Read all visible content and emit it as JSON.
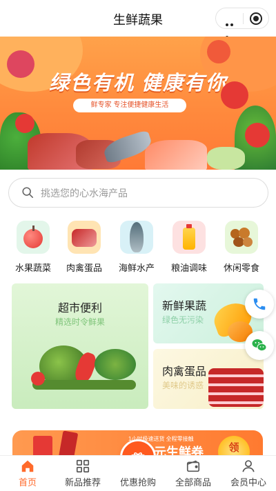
{
  "header": {
    "title": "生鲜蔬果"
  },
  "banner": {
    "headline": "绿色有机 健康有你",
    "tagline": "鲜专家 专注便捷健康生活"
  },
  "search": {
    "placeholder": "挑选您的心水海产品"
  },
  "categories": [
    {
      "label": "水果蔬菜",
      "icon": "apple-icon"
    },
    {
      "label": "肉禽蛋品",
      "icon": "meat-icon"
    },
    {
      "label": "海鲜水产",
      "icon": "fish-icon"
    },
    {
      "label": "粮油调味",
      "icon": "oil-bottle-icon"
    },
    {
      "label": "休闲零食",
      "icon": "snack-icon"
    }
  ],
  "cards": {
    "supermarket": {
      "title": "超市便利",
      "subtitle": "精选时令鲜果"
    },
    "fresh_fruit": {
      "title": "新鲜果蔬",
      "subtitle": "绿色无污染"
    },
    "meat_eggs": {
      "title": "肉禽蛋品",
      "subtitle": "美味的诱惑"
    }
  },
  "promo": {
    "notice": "1小时极速送货 全程零接触",
    "main": "元生鲜券",
    "button": "领"
  },
  "tabbar": {
    "items": [
      {
        "label": "首页",
        "icon": "home-icon",
        "active": true
      },
      {
        "label": "新品推荐",
        "icon": "grid-icon",
        "active": false
      },
      {
        "label": "优惠抢购",
        "icon": "gift-icon",
        "active": false
      },
      {
        "label": "全部商品",
        "icon": "wallet-icon",
        "active": false
      },
      {
        "label": "会员中心",
        "icon": "user-icon",
        "active": false
      }
    ]
  },
  "colors": {
    "accent": "#ff6a2b",
    "banner": "#ff8a3d",
    "card_green": "#dff5d6",
    "card_mint": "#dff7ec",
    "card_cream": "#fbf6dc"
  }
}
